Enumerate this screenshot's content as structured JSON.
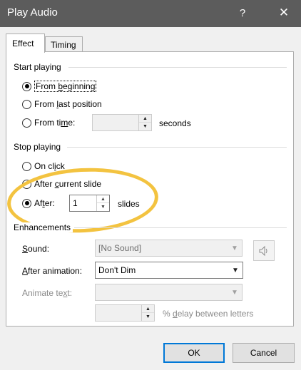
{
  "window": {
    "title": "Play Audio",
    "help_label": "?",
    "close_label": "✕"
  },
  "tabs": [
    {
      "label": "Effect",
      "selected": true
    },
    {
      "label": "Timing",
      "selected": false
    }
  ],
  "start_playing": {
    "title": "Start playing",
    "options": [
      {
        "pre": "From ",
        "key": "b",
        "post": "eginning",
        "checked": true
      },
      {
        "pre": "From ",
        "key": "l",
        "post": "ast position",
        "checked": false
      },
      {
        "pre": "From ti",
        "key": "m",
        "post": "e:",
        "checked": false
      }
    ],
    "time_value": "",
    "time_unit": "seconds"
  },
  "stop_playing": {
    "title": "Stop playing",
    "options": [
      {
        "pre": "On cl",
        "key": "i",
        "post": "ck",
        "checked": false
      },
      {
        "pre": "After ",
        "key": "c",
        "post": "urrent slide",
        "checked": false
      },
      {
        "pre": "Af",
        "key": "t",
        "post": "er:",
        "checked": true
      }
    ],
    "after_value": "1",
    "after_unit": "slides"
  },
  "enhancements": {
    "title": "Enhancements",
    "sound_label_pre": "",
    "sound_label_key": "S",
    "sound_label_post": "ound:",
    "sound_value": "[No Sound]",
    "after_animation_pre": "",
    "after_animation_key": "A",
    "after_animation_post": "fter animation:",
    "after_animation_value": "Don't Dim",
    "animate_text_pre": "Animate te",
    "animate_text_key": "x",
    "animate_text_post": "t:",
    "animate_text_value": "",
    "delay_value": "",
    "delay_pre": "% ",
    "delay_key": "d",
    "delay_post": "elay between letters"
  },
  "buttons": {
    "ok": "OK",
    "cancel": "Cancel"
  },
  "colors": {
    "titlebar": "#5c5c5c",
    "highlight": "#f3c340",
    "default_button_border": "#0078d7"
  }
}
